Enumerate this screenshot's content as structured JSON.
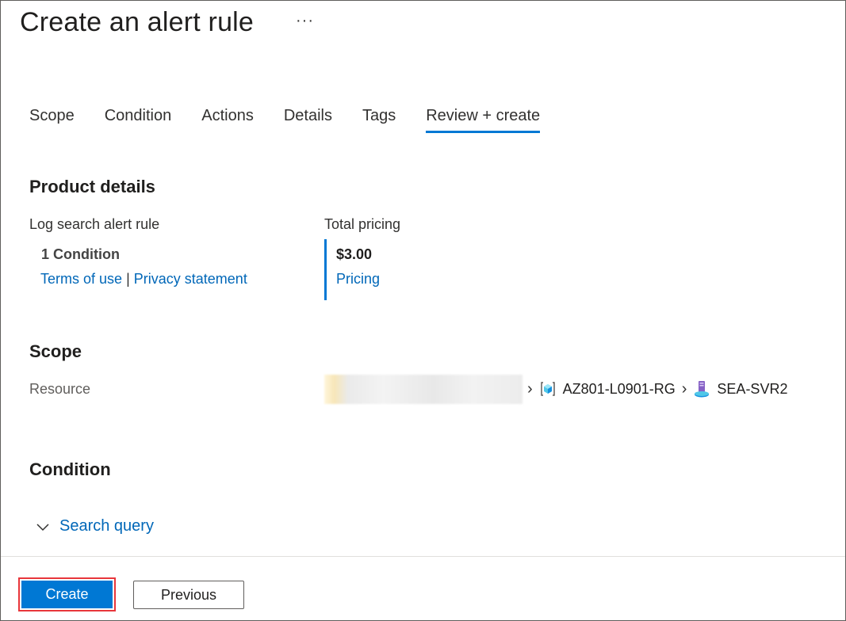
{
  "header": {
    "title": "Create an alert rule",
    "more_label": "···"
  },
  "tabs": [
    {
      "label": "Scope",
      "active": false
    },
    {
      "label": "Condition",
      "active": false
    },
    {
      "label": "Actions",
      "active": false
    },
    {
      "label": "Details",
      "active": false
    },
    {
      "label": "Tags",
      "active": false
    },
    {
      "label": "Review + create",
      "active": true
    }
  ],
  "product_details": {
    "title": "Product details",
    "rule_type": "Log search alert rule",
    "condition_count": "1 Condition",
    "terms_link": "Terms of use",
    "separator": "|",
    "privacy_link": "Privacy statement",
    "total_pricing_label": "Total pricing",
    "price": "$3.00",
    "pricing_link": "Pricing"
  },
  "scope": {
    "title": "Scope",
    "resource_label": "Resource",
    "resource_group": "AZ801-L0901-RG",
    "resource_name": "SEA-SVR2"
  },
  "condition": {
    "title": "Condition",
    "search_query_label": "Search query"
  },
  "footer": {
    "create_label": "Create",
    "previous_label": "Previous"
  },
  "colors": {
    "accent": "#0078d4",
    "link": "#0067b8",
    "highlight_border": "#e8363b"
  }
}
